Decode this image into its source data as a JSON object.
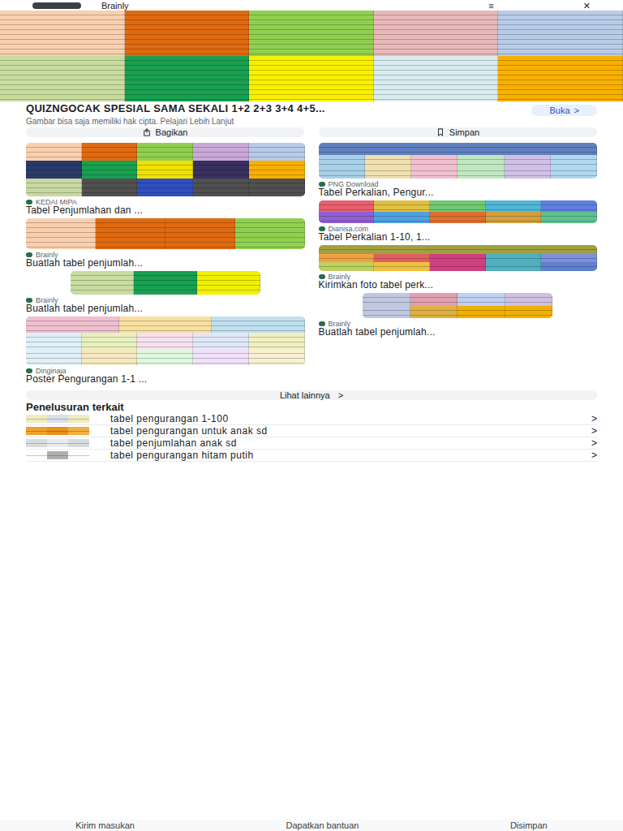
{
  "top_bar": {
    "source": "Brainly",
    "menu": "≡",
    "close": "✕"
  },
  "preview": {
    "rows": [
      [
        "#f8d0b0",
        "#e06a10",
        "#90d050",
        "#e8b8b8",
        "#b8cce8"
      ],
      [
        "#c8dca0",
        "#18a050",
        "#f8f000",
        "#d8ecf0",
        "#f8b000"
      ]
    ],
    "title": "QUIZNGOCAK SPESIAL SAMA SEKALI 1+2 2+3 3+4 4+5...",
    "open_button": "Buka",
    "open_arrow": ">",
    "notice": "Gambar bisa saja memiliki hak cipta. Pelajari Lebih Lanjut",
    "share_button": "Bagikan",
    "save_button": "Simpan"
  },
  "results": {
    "left": [
      {
        "source": "KEDAI MIPA",
        "title": "Tabel Penjumlahan dan ...",
        "rows": [
          [
            "#f8d0b0",
            "#e06a10",
            "#90d050",
            "#c8a8d8",
            "#b8cce8"
          ],
          [
            "#2a3a6a",
            "#18a050",
            "#f0e000",
            "#3a3060",
            "#f8b000"
          ],
          [
            "#c8d8a0",
            "#505050",
            "#3050c0",
            "#505050",
            "#505050"
          ]
        ]
      },
      {
        "source": "Brainly",
        "title": "Buatlah tabel penjumlah...",
        "rows": [
          [
            "#f8d0b0",
            "#e06a10",
            "#e06a10",
            "#90d050"
          ]
        ]
      },
      {
        "source": "Brainly",
        "title": "Buatlah tabel penjumlah...",
        "rows": [
          [
            "#c8dca0",
            "#18a050",
            "#f0f000"
          ]
        ]
      },
      {
        "source": "Dinginaja",
        "title": "Poster Pengurangan 1-1 ...",
        "rows": [
          [
            "#f0c0d0",
            "#f8e0a0",
            "#c0e0f0"
          ],
          [
            "#e0f0f8",
            "#e8f0c0",
            "#f8e0f0",
            "#e0e8f8",
            "#f0f0c0"
          ],
          [
            "#e0f0f8",
            "#f8e8c0",
            "#e0f8e0",
            "#f0e0f8",
            "#f8f0d0"
          ]
        ]
      }
    ],
    "right": [
      {
        "source": "PNG Download",
        "title": "Tabel Perkalian, Pengur...",
        "rows": [
          [
            "#6080c0"
          ],
          [
            "#a8d0e8",
            "#f0e0b0",
            "#f0c0d0",
            "#c0e8c0",
            "#d0c0e8",
            "#b0d8f0"
          ],
          [
            "#a8d0e8",
            "#f0e0b0",
            "#f0c0d0",
            "#c0e8c0",
            "#d0c0e8",
            "#b0d8f0"
          ]
        ]
      },
      {
        "source": "Dianisa.com",
        "title": "Tabel Perkalian 1-10, 1...",
        "rows": [
          [
            "#e86070",
            "#e0c040",
            "#70c870",
            "#50b8d8",
            "#6080e0"
          ],
          [
            "#9060d0",
            "#50a0e0",
            "#e07030",
            "#d0a040",
            "#60c090"
          ]
        ]
      },
      {
        "source": "Brainly",
        "title": "Kirimkan foto tabel perk...",
        "rows": [
          [
            "#a0a040"
          ],
          [
            "#f0a040",
            "#e06060",
            "#d04080",
            "#50b0c0",
            "#8090e0"
          ],
          [
            "#c0d060",
            "#f0c040",
            "#d04080",
            "#50b0c0",
            "#6080d0"
          ]
        ]
      },
      {
        "source": "Brainly",
        "title": "Buatlah tabel penjumlah...",
        "rows": [
          [
            "#c0c8e0",
            "#e0a0b0",
            "#c0d0f0",
            "#d0c0e0"
          ],
          [
            "#c0c8e0",
            "#e0b040",
            "#f0b000",
            "#f0b000"
          ]
        ]
      }
    ]
  },
  "more_button": {
    "label": "Lihat lainnya",
    "arrow": ">"
  },
  "related": {
    "heading": "Penelusuran terkait",
    "items": [
      {
        "label": "tabel pengurangan 1-100",
        "arrow": ">",
        "colors": [
          "#f0ecc0",
          "#d8e0e8",
          "#f0ecc0"
        ]
      },
      {
        "label": "tabel pengurangan untuk anak sd",
        "arrow": ">",
        "colors": [
          "#f0a030",
          "#e89020",
          "#f0b040"
        ]
      },
      {
        "label": "tabel penjumlahan anak sd",
        "arrow": ">",
        "colors": [
          "#d8dce0",
          "#e8ecf0",
          "#d8dce0"
        ]
      },
      {
        "label": "tabel pengurangan hitam putih",
        "arrow": ">",
        "colors": [
          "#ffffff",
          "#b0b0b0",
          "#ffffff"
        ]
      }
    ]
  },
  "footer": [
    "Kirim masukan",
    "Dapatkan bantuan",
    "Disimpan"
  ]
}
